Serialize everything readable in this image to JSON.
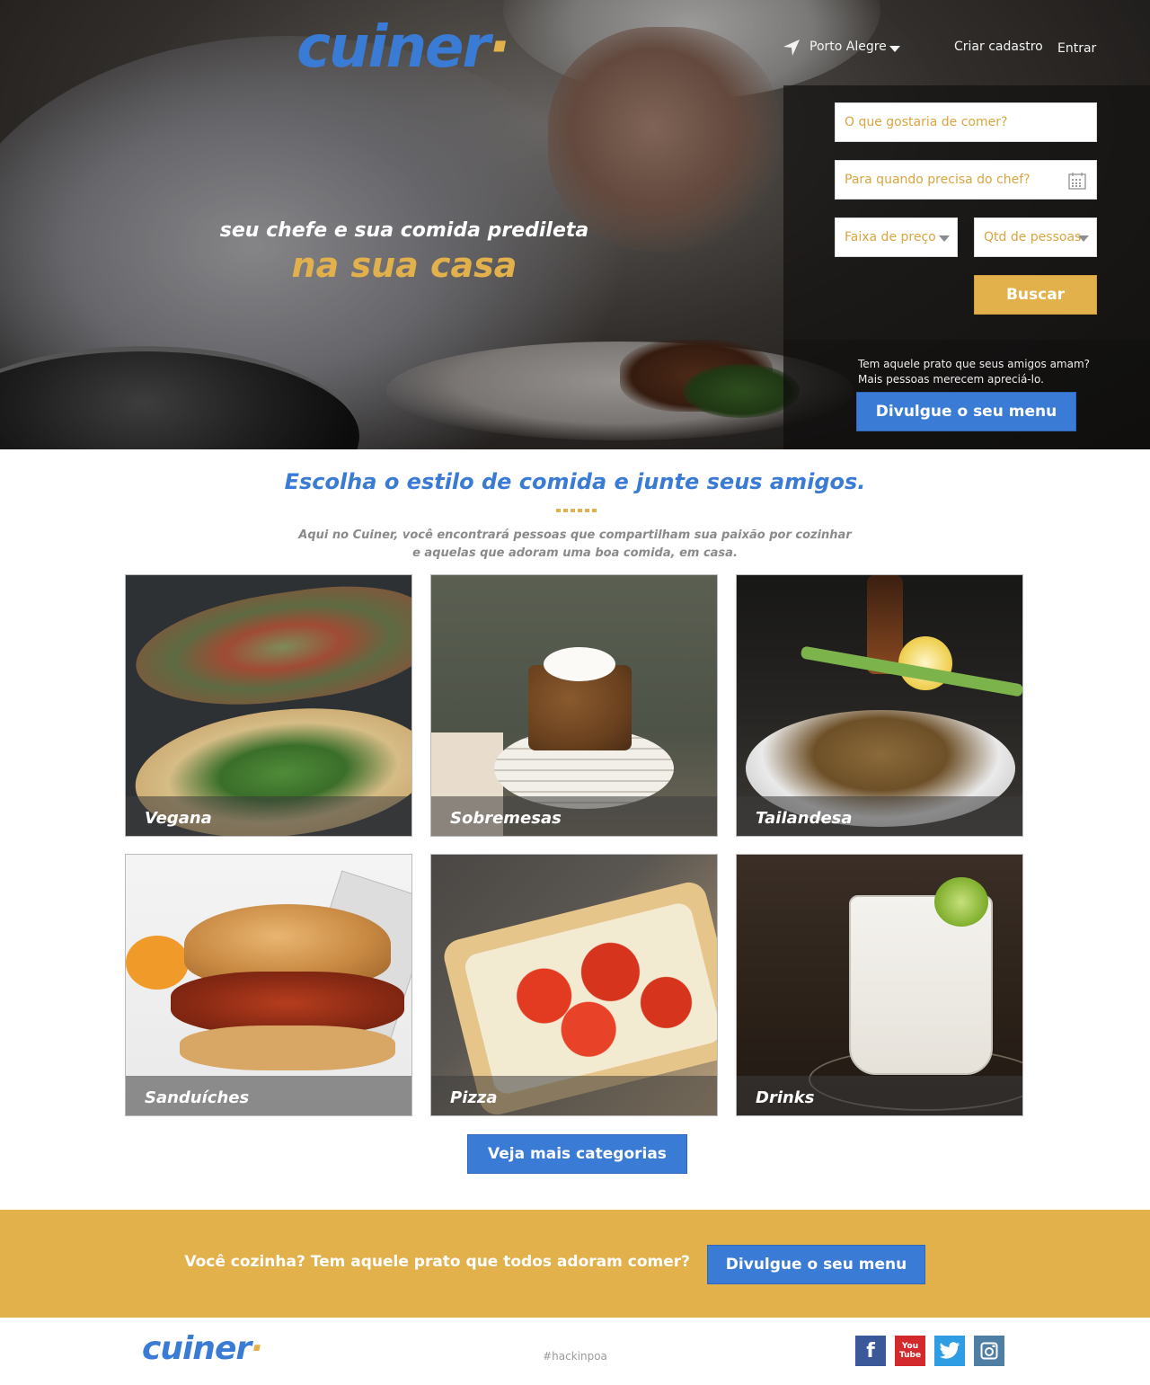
{
  "brand": {
    "name": "cuiner",
    "dot": "·",
    "primary_color": "#3a7bd5",
    "accent_color": "#e3b14c"
  },
  "header": {
    "location": "Porto Alegre",
    "signup_label": "Criar cadastro",
    "login_label": "Entrar",
    "location_icon": "location-arrow-icon"
  },
  "hero": {
    "tagline_line1": "seu chefe e sua comida predileta",
    "tagline_line2": "na sua casa"
  },
  "search": {
    "what_placeholder": "O que gostaria de comer?",
    "when_placeholder": "Para quando precisa do chef?",
    "price_label": "Faixa de preço",
    "people_label": "Qtd de pessoas",
    "submit_label": "Buscar",
    "calendar_icon": "calendar-icon"
  },
  "promo": {
    "line1": "Tem aquele prato que seus amigos amam?",
    "line2": "Mais pessoas merecem apreciá-lo.",
    "button_label": "Divulgue o seu menu"
  },
  "categories": {
    "title": "Escolha o estilo de comida e junte seus amigos.",
    "subtitle_line1": "Aqui no Cuiner, você encontrará pessoas que compartilham sua paixão por cozinhar",
    "subtitle_line2": "e aquelas que adoram uma boa comida, em casa.",
    "items": [
      {
        "label": "Vegana"
      },
      {
        "label": "Sobremesas"
      },
      {
        "label": "Tailandesa"
      },
      {
        "label": "Sanduíches"
      },
      {
        "label": "Pizza"
      },
      {
        "label": "Drinks"
      }
    ],
    "more_label": "Veja mais categorias"
  },
  "cta": {
    "text": "Você cozinha? Tem aquele prato que todos adoram comer?",
    "button_label": "Divulgue o seu menu"
  },
  "footer": {
    "hashtag": "#hackinpoa",
    "social": {
      "facebook": "f",
      "youtube_top": "You",
      "youtube_bottom": "Tube",
      "icons": [
        "facebook-icon",
        "youtube-icon",
        "twitter-icon",
        "instagram-icon"
      ]
    }
  }
}
